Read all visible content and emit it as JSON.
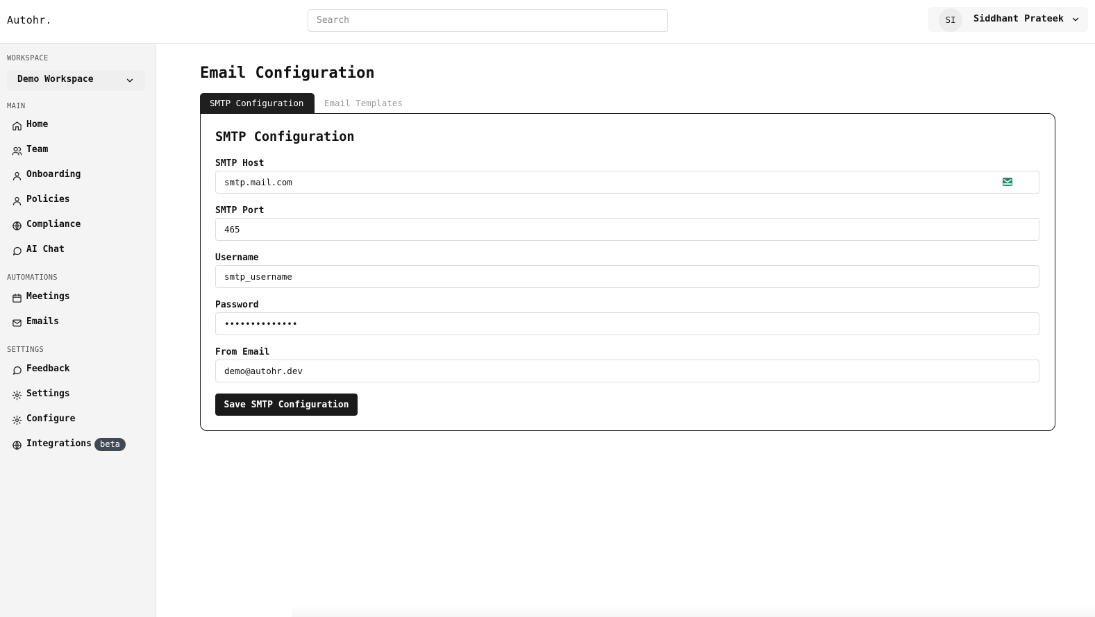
{
  "app": {
    "brand": "Autohr."
  },
  "header": {
    "search_placeholder": "Search",
    "user": {
      "initials": "SI",
      "name": "Siddhant Prateek"
    }
  },
  "sidebar": {
    "workspace_label": "WORKSPACE",
    "workspace_value": "Demo Workspace",
    "sections": {
      "main": "MAIN",
      "automations": "AUTOMATIONS",
      "settings": "SETTINGS"
    },
    "main_items": [
      {
        "label": "Home",
        "icon": "home-icon"
      },
      {
        "label": "Team",
        "icon": "users-icon"
      },
      {
        "label": "Onboarding",
        "icon": "user-icon"
      },
      {
        "label": "Policies",
        "icon": "user-icon"
      },
      {
        "label": "Compliance",
        "icon": "globe-icon"
      },
      {
        "label": "AI Chat",
        "icon": "chat-icon"
      }
    ],
    "automation_items": [
      {
        "label": "Meetings",
        "icon": "calendar-icon"
      },
      {
        "label": "Emails",
        "icon": "mail-icon"
      }
    ],
    "settings_items": [
      {
        "label": "Feedback",
        "icon": "chat-icon"
      },
      {
        "label": "Settings",
        "icon": "gear-icon"
      },
      {
        "label": "Configure",
        "icon": "gear-icon"
      },
      {
        "label": "Integrations",
        "icon": "globe-icon",
        "badge": "beta"
      }
    ]
  },
  "main": {
    "page_title": "Email Configuration",
    "tabs": [
      {
        "label": "SMTP Configuration",
        "active": true
      },
      {
        "label": "Email Templates",
        "active": false
      }
    ],
    "card": {
      "title": "SMTP Configuration",
      "fields": [
        {
          "label": "SMTP Host",
          "value": "smtp.mail.com"
        },
        {
          "label": "SMTP Port",
          "value": "465"
        },
        {
          "label": "Username",
          "value": "smtp_username"
        },
        {
          "label": "Password",
          "value": "••••••••••••••"
        },
        {
          "label": "From Email",
          "value": "demo@autohr.dev"
        }
      ],
      "save_label": "Save SMTP Configuration"
    }
  },
  "colors": {
    "accent": "#1a1a1a",
    "sidebar_bg": "#f4f4f5",
    "badge_bg": "#3f4a55",
    "mail_badge": "#1f8a6b"
  }
}
